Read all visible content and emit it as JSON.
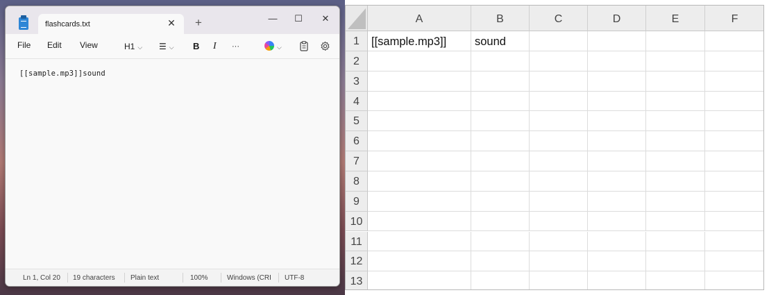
{
  "notepad": {
    "tab_title": "flashcards.txt",
    "tab_close_glyph": "✕",
    "new_tab_glyph": "+",
    "window_controls": {
      "minimize": "—",
      "maximize": "☐",
      "close": "✕"
    },
    "menu": {
      "file": "File",
      "edit": "Edit",
      "view": "View"
    },
    "toolbar": {
      "heading": "H1",
      "list_glyph": "☰",
      "bold": "B",
      "italic": "I",
      "more": "···",
      "chevron": "⌵",
      "icons": [
        "copilot-icon",
        "clipboard-icon",
        "gear-icon",
        "list-icon",
        "bold-icon",
        "italic-icon",
        "more-icon"
      ]
    },
    "content": "[[sample.mp3]]sound",
    "status": {
      "position": "Ln 1, Col 20",
      "characters": "19 characters",
      "format": "Plain text",
      "zoom": "100%",
      "line_ending": "Windows (CRI",
      "encoding": "UTF-8"
    }
  },
  "spreadsheet": {
    "columns": [
      "A",
      "B",
      "C",
      "D",
      "E",
      "F"
    ],
    "rows": [
      "1",
      "2",
      "3",
      "4",
      "5",
      "6",
      "7",
      "8",
      "9",
      "10",
      "11",
      "12",
      "13"
    ],
    "cells": {
      "A1": "[[sample.mp3]]",
      "B1": "sound"
    }
  }
}
